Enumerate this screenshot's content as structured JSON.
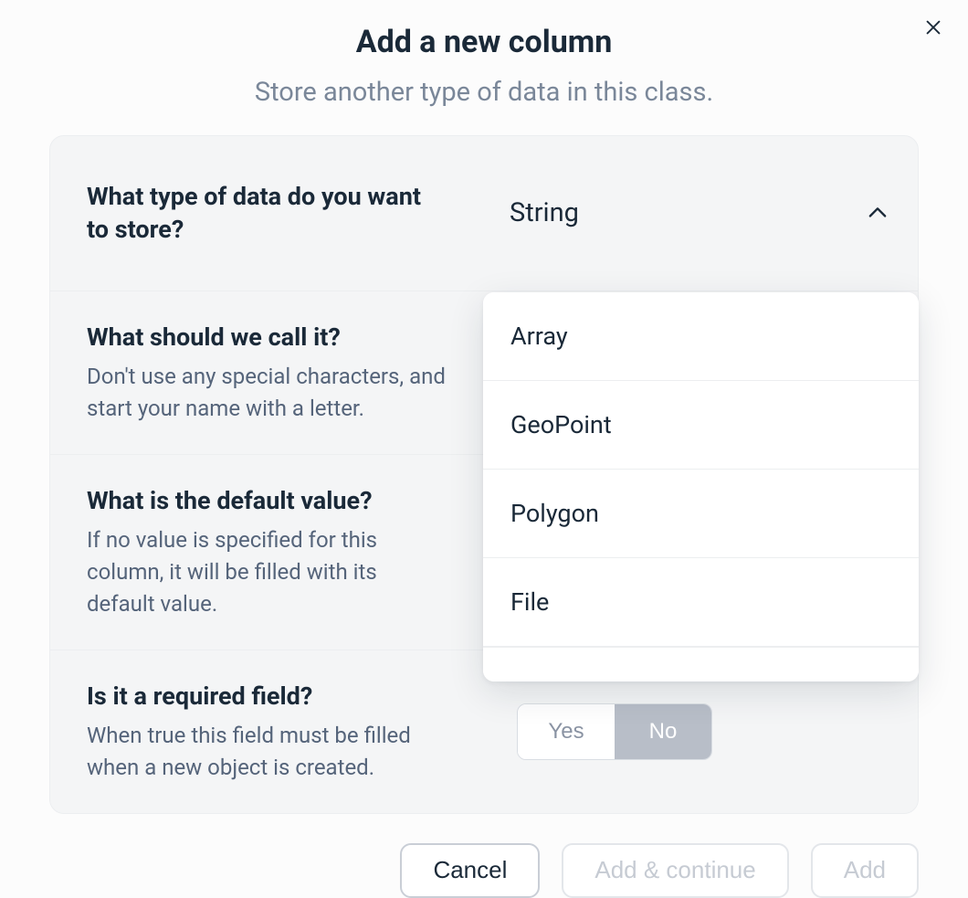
{
  "header": {
    "title": "Add a new column",
    "subtitle": "Store another type of data in this class."
  },
  "rows": {
    "type": {
      "title": "What type of data do you want to store?",
      "selected": "String"
    },
    "name": {
      "title": "What should we call it?",
      "desc": "Don't use any special characters, and start your name with a letter."
    },
    "default": {
      "title": "What is the default value?",
      "desc": "If no value is specified for this column, it will be filled with its default value."
    },
    "required": {
      "title": "Is it a required field?",
      "desc": "When true this field must be filled when a new object is created.",
      "yes": "Yes",
      "no": "No"
    }
  },
  "dropdown": {
    "items": [
      "Array",
      "GeoPoint",
      "Polygon",
      "File"
    ]
  },
  "footer": {
    "cancel": "Cancel",
    "add_continue": "Add & continue",
    "add": "Add"
  }
}
